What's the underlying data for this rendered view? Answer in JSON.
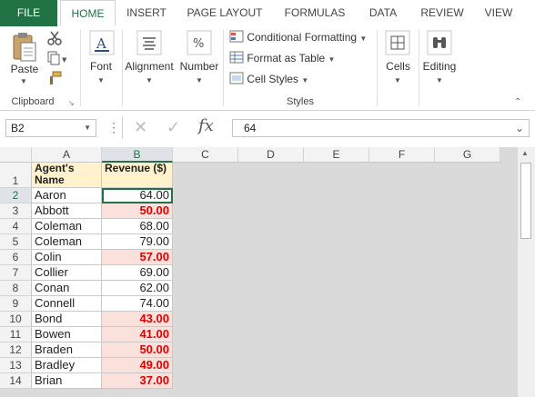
{
  "tabs": [
    "FILE",
    "HOME",
    "INSERT",
    "PAGE LAYOUT",
    "FORMULAS",
    "DATA",
    "REVIEW",
    "VIEW"
  ],
  "ribbon": {
    "clipboard": {
      "paste": "Paste",
      "label": "Clipboard"
    },
    "font": "Font",
    "alignment": "Alignment",
    "number": "Number",
    "styles": {
      "conditional": "Conditional Formatting",
      "format_table": "Format as Table",
      "cell_styles": "Cell Styles",
      "label": "Styles"
    },
    "cells": "Cells",
    "editing": "Editing"
  },
  "formula_bar": {
    "name_box": "B2",
    "fx": "fx",
    "value": "64"
  },
  "columns": [
    "A",
    "B",
    "C",
    "D",
    "E",
    "F",
    "G"
  ],
  "rows": [
    1,
    2,
    3,
    4,
    5,
    6,
    7,
    8,
    9,
    10,
    11,
    12,
    13,
    14
  ],
  "header": {
    "a": "Agent's Name",
    "b": "Revenue ($)"
  },
  "data": [
    {
      "name": "Aaron",
      "rev": "64.00",
      "flag": false
    },
    {
      "name": "Abbott",
      "rev": "50.00",
      "flag": true
    },
    {
      "name": "Coleman",
      "rev": "68.00",
      "flag": false
    },
    {
      "name": "Coleman",
      "rev": "79.00",
      "flag": false
    },
    {
      "name": "Colin",
      "rev": "57.00",
      "flag": true
    },
    {
      "name": "Collier",
      "rev": "69.00",
      "flag": false
    },
    {
      "name": "Conan",
      "rev": "62.00",
      "flag": false
    },
    {
      "name": "Connell",
      "rev": "74.00",
      "flag": false
    },
    {
      "name": "Bond",
      "rev": "43.00",
      "flag": true
    },
    {
      "name": "Bowen",
      "rev": "41.00",
      "flag": true
    },
    {
      "name": "Braden",
      "rev": "50.00",
      "flag": true
    },
    {
      "name": "Bradley",
      "rev": "49.00",
      "flag": true
    },
    {
      "name": "Brian",
      "rev": "37.00",
      "flag": true
    }
  ],
  "colors": {
    "accent": "#217346",
    "highlight_fill": "#fbe1dc",
    "highlight_text": "#e00000",
    "header_fill": "#fff2cc"
  }
}
